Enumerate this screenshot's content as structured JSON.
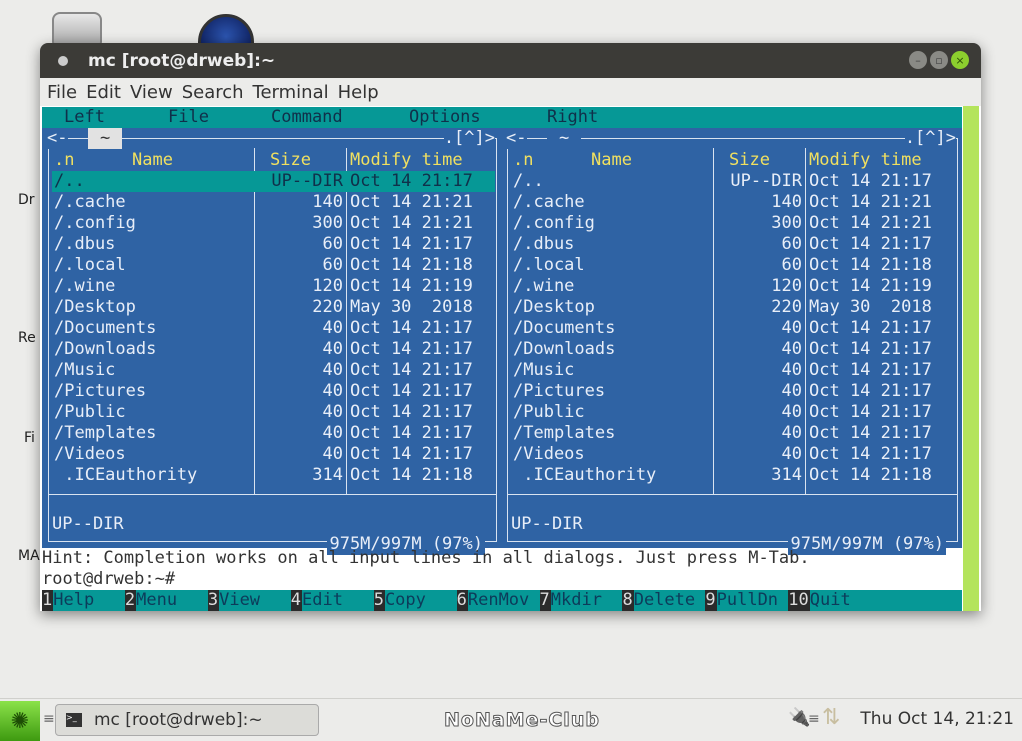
{
  "desktop": {
    "labels": [
      "Dr",
      "Re",
      "Fi",
      "MA"
    ]
  },
  "window": {
    "title": "mc [root@drweb]:~"
  },
  "menubar": [
    "File",
    "Edit",
    "View",
    "Search",
    "Terminal",
    "Help"
  ],
  "mc_menu": [
    "Left",
    "File",
    "Command",
    "Options",
    "Right"
  ],
  "headers": {
    "n": ".n",
    "name": "Name",
    "size": "Size",
    "mtime": "Modify time"
  },
  "left": {
    "path": "~",
    "nav_left": "<-",
    "nav_right": ".[^]>",
    "status": "UP--DIR",
    "free": "975M/997M (97%)"
  },
  "right": {
    "path": "~",
    "nav_left": "<-",
    "nav_right": ".[^]>",
    "status": "UP--DIR",
    "free": "975M/997M (97%)"
  },
  "files": [
    {
      "name": "/..",
      "size": "UP--DIR",
      "mtime": "Oct 14 21:17"
    },
    {
      "name": "/.cache",
      "size": "140",
      "mtime": "Oct 14 21:21"
    },
    {
      "name": "/.config",
      "size": "300",
      "mtime": "Oct 14 21:21"
    },
    {
      "name": "/.dbus",
      "size": "60",
      "mtime": "Oct 14 21:17"
    },
    {
      "name": "/.local",
      "size": "60",
      "mtime": "Oct 14 21:18"
    },
    {
      "name": "/.wine",
      "size": "120",
      "mtime": "Oct 14 21:19"
    },
    {
      "name": "/Desktop",
      "size": "220",
      "mtime": "May 30  2018"
    },
    {
      "name": "/Documents",
      "size": "40",
      "mtime": "Oct 14 21:17"
    },
    {
      "name": "/Downloads",
      "size": "40",
      "mtime": "Oct 14 21:17"
    },
    {
      "name": "/Music",
      "size": "40",
      "mtime": "Oct 14 21:17"
    },
    {
      "name": "/Pictures",
      "size": "40",
      "mtime": "Oct 14 21:17"
    },
    {
      "name": "/Public",
      "size": "40",
      "mtime": "Oct 14 21:17"
    },
    {
      "name": "/Templates",
      "size": "40",
      "mtime": "Oct 14 21:17"
    },
    {
      "name": "/Videos",
      "size": "40",
      "mtime": "Oct 14 21:17"
    },
    {
      "name": " .ICEauthority",
      "size": "314",
      "mtime": "Oct 14 21:18"
    }
  ],
  "hint": "Hint: Completion works on all input lines in all dialogs. Just press M-Tab.",
  "prompt": "root@drweb:~#",
  "fkeys": [
    {
      "n": "1",
      "l": "Help  "
    },
    {
      "n": "2",
      "l": "Menu  "
    },
    {
      "n": "3",
      "l": "View  "
    },
    {
      "n": "4",
      "l": "Edit  "
    },
    {
      "n": "5",
      "l": "Copy  "
    },
    {
      "n": "6",
      "l": "RenMov"
    },
    {
      "n": "7",
      "l": "Mkdir "
    },
    {
      "n": "8",
      "l": "Delete"
    },
    {
      "n": "9",
      "l": "PullDn"
    },
    {
      "n": "10",
      "l": "Quit"
    }
  ],
  "taskbar": {
    "task": "mc [root@drweb]:~",
    "brand": "NoNaMe-Club",
    "clock": "Thu Oct 14, 21:21"
  }
}
